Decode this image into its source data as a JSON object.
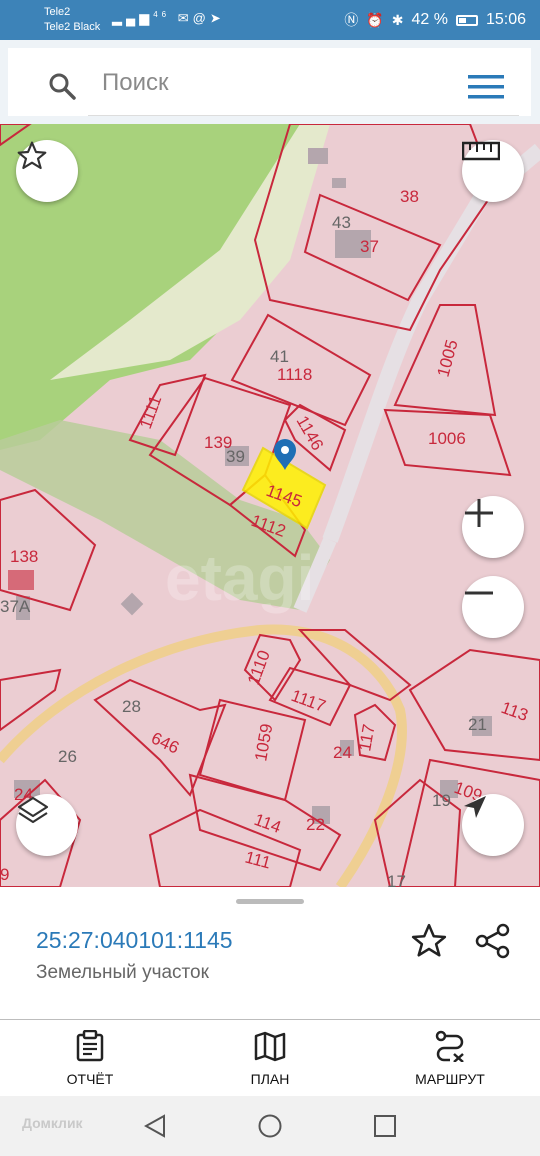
{
  "status_bar": {
    "carrier_1": "Tele2",
    "carrier_2": "Tele2 Black",
    "network": "46",
    "battery": "42 %",
    "battery_level": 0.42,
    "time": "15:06"
  },
  "search": {
    "placeholder": "Поиск"
  },
  "map": {
    "parcel_labels": [
      "38",
      "43",
      "37",
      "1005",
      "41",
      "1118",
      "1111",
      "139",
      "39",
      "1146",
      "1006",
      "1145",
      "1112",
      "138",
      "37А",
      "1110",
      "1117",
      "28",
      "646",
      "1059",
      "117",
      "24",
      "21",
      "113",
      "26",
      "24",
      "114",
      "22",
      "109",
      "19",
      "111",
      "17",
      "9"
    ],
    "watermark": "etagi",
    "selected_marker": "location-pin-icon"
  },
  "parcel_card": {
    "cadastral_number": "25:27:040101:1145",
    "type": "Земельный участок"
  },
  "bottom_tabs": [
    {
      "label": "ОТЧЁТ",
      "icon": "clipboard-icon"
    },
    {
      "label": "ПЛАН",
      "icon": "map-plan-icon"
    },
    {
      "label": "МАРШРУТ",
      "icon": "route-icon"
    }
  ],
  "navbar": {
    "watermark": "Домклик"
  },
  "colors": {
    "status_bar": "#3d83b8",
    "accent": "#2b7ab8",
    "parcel_border": "#c8283c",
    "selected_parcel": "#fff200",
    "forest": "#a8d27c"
  }
}
